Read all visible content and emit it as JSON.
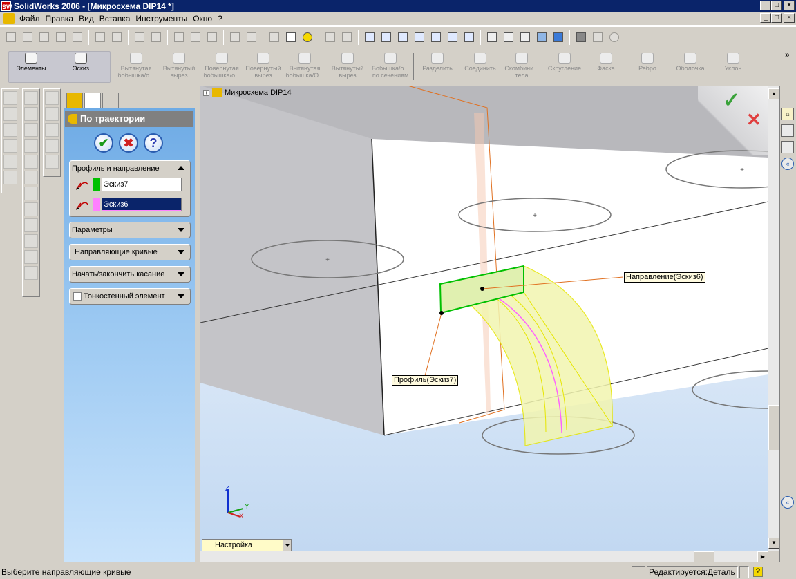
{
  "window": {
    "title": "SolidWorks 2006 - [Микросхема DIP14 *]",
    "logo": "SW"
  },
  "menu": {
    "items": [
      "Файл",
      "Правка",
      "Вид",
      "Вставка",
      "Инструменты",
      "Окно",
      "?"
    ]
  },
  "features_toolbar": {
    "items": [
      {
        "label": "Элементы",
        "active": true
      },
      {
        "label": "Эскиз",
        "active": true
      },
      {
        "label": "Вытянутая бобышка/о...",
        "active": false
      },
      {
        "label": "Вытянутый вырез",
        "active": false
      },
      {
        "label": "Повернутая бобышка/о...",
        "active": false
      },
      {
        "label": "Повернутый вырез",
        "active": false
      },
      {
        "label": "Вытянутая бобышка/О...",
        "active": false
      },
      {
        "label": "Вытянутый вырез",
        "active": false
      },
      {
        "label": "Бобышка/о... по сечениям",
        "active": false
      },
      {
        "label": "Разделить",
        "active": false
      },
      {
        "label": "Соединить",
        "active": false
      },
      {
        "label": "Скомбини... тела",
        "active": false
      },
      {
        "label": "Скругление",
        "active": false
      },
      {
        "label": "Фаска",
        "active": false
      },
      {
        "label": "Ребро",
        "active": false
      },
      {
        "label": "Оболочка",
        "active": false
      },
      {
        "label": "Уклон",
        "active": false
      }
    ]
  },
  "property_manager": {
    "title": "По траектории",
    "groups": {
      "profile_path": {
        "label": "Профиль и направление",
        "profile": {
          "value": "Эскиз7",
          "color": "#00c000"
        },
        "path": {
          "value": "Эскиз6",
          "color": "#ff80ff"
        }
      },
      "options": {
        "label": "Параметры"
      },
      "guides": {
        "label": "Направляющие кривые"
      },
      "tangency": {
        "label": "Начать/закончить касание"
      },
      "thin": {
        "label": "Тонкостенный элемент",
        "checked": false
      }
    }
  },
  "graphics": {
    "tree_root": "Микросхема DIP14",
    "callout_path": "Направление(Эскиз6)",
    "callout_profile": "Профиль(Эскиз7)",
    "axis_x": "X",
    "axis_y": "Y",
    "axis_z": "Z",
    "view_combo": "Настройка"
  },
  "status": {
    "prompt": "Выберите направляющие кривые",
    "mode": "Редактируется:Деталь",
    "help": "?"
  }
}
